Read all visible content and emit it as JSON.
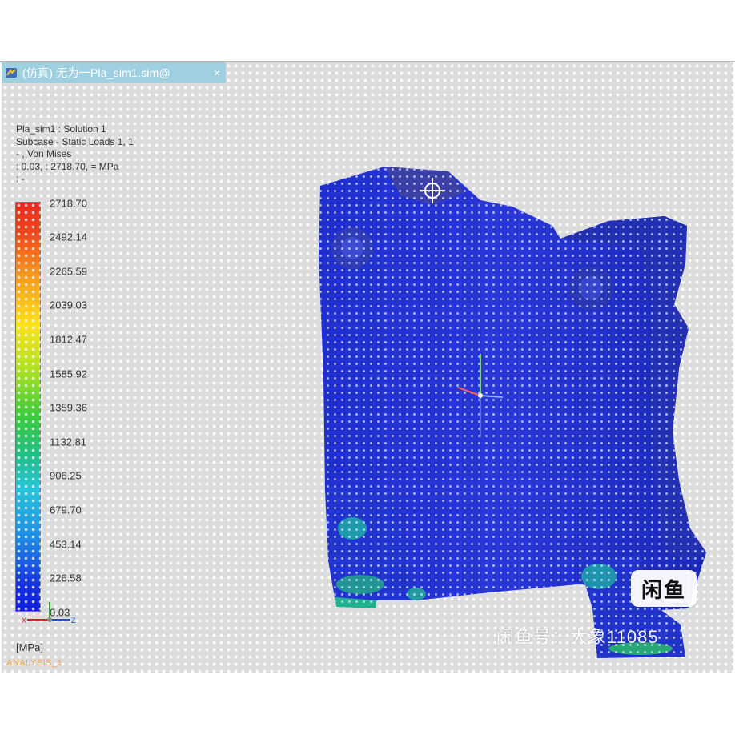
{
  "window": {
    "tab_title": "(仿真) 无为一Pla_sim1.sim@",
    "close_glyph": "×",
    "icon": "nx-app-icon"
  },
  "result_info": {
    "line1": "Pla_sim1 : Solution 1",
    "line2": "Subcase - Static Loads 1, 1",
    "line3": "- , Von Mises",
    "line4": ": 0.03, : 2718.70, = MPa",
    "line5": ": -"
  },
  "legend": {
    "ticks": [
      "2718.70",
      "2492.14",
      "2265.59",
      "2039.03",
      "1812.47",
      "1585.92",
      "1359.36",
      "1132.81",
      "906.25",
      "679.70",
      "453.14",
      "226.58",
      "0.03"
    ],
    "units": "[MPa]",
    "colors": {
      "max": "#e8281e",
      "mid": "#3ccc3a",
      "min": "#101de0"
    }
  },
  "layer_label": "ANALYSIS_1",
  "triad": {
    "x": "X",
    "y": "Y",
    "z": "Z"
  },
  "watermark": {
    "badge": "闲鱼",
    "text": "闲鱼号：大象11085"
  }
}
